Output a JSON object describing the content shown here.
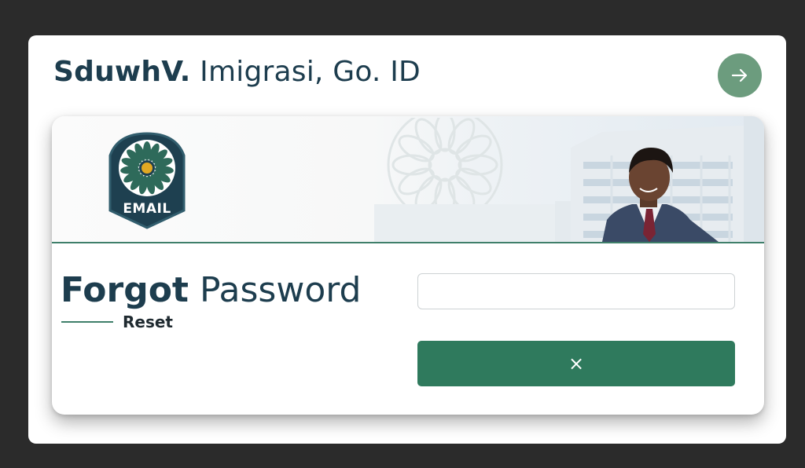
{
  "header": {
    "brand": "SduwhV.",
    "domain": "Imigrasi, Go. ID",
    "go_icon": "arrow-right-icon"
  },
  "banner": {
    "emblem_label": "EMAIL",
    "emblem_icon": "flower-emblem-icon",
    "watermark_icon": "flower-watermark-icon",
    "photo": "man-in-suit-photo"
  },
  "form": {
    "heading_bold": "Forgot",
    "heading_light": "Password",
    "sub_label": "Reset",
    "email_value": "",
    "email_placeholder": "",
    "submit_icon": "close-icon",
    "submit_glyph": "×"
  },
  "colors": {
    "accent": "#2f7a5d",
    "go_button": "#6c9c7e",
    "title": "#1d3d4e",
    "background": "#2b2b2b"
  }
}
